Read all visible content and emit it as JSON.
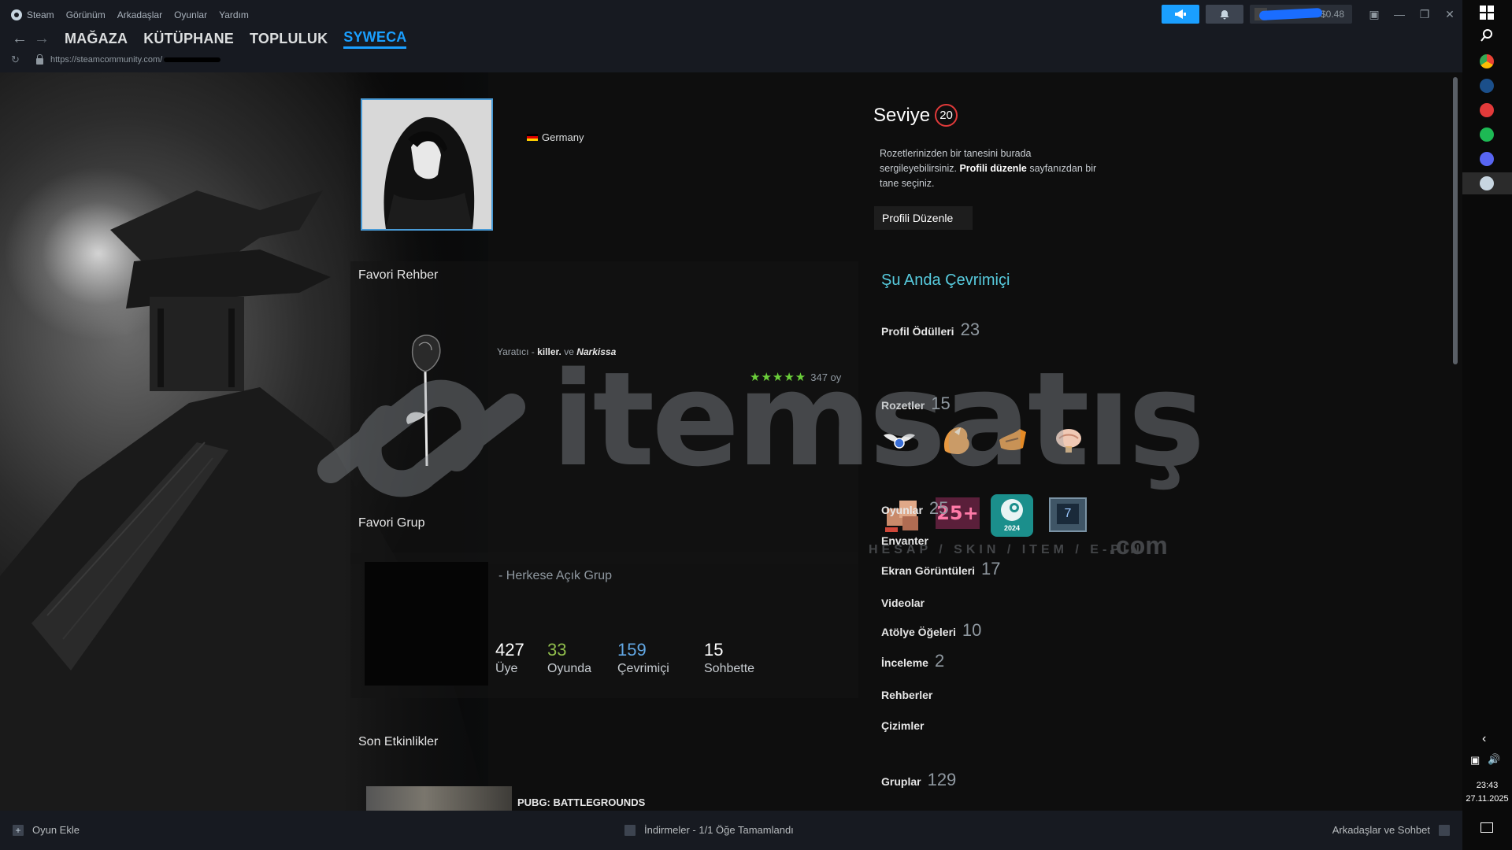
{
  "menu": {
    "app_name": "Steam",
    "items": [
      "Görünüm",
      "Arkadaşlar",
      "Oyunlar",
      "Yardım"
    ]
  },
  "nav": {
    "tabs": [
      "MAĞAZA",
      "KÜTÜPHANE",
      "TOPLULUK",
      "SYWECA"
    ],
    "active_tab": "SYWECA",
    "url": "https://steamcommunity.com/"
  },
  "account": {
    "balance": "$0.48"
  },
  "profile": {
    "country": "Germany",
    "level_label": "Seviye",
    "level": "20",
    "showcase_text_1": "Rozetlerinizden bir tanesini burada sergileyebilirsiniz.",
    "showcase_bold": "Profili düzenle",
    "showcase_text_2": "sayfanızdan bir tane seçiniz.",
    "edit_button": "Profili Düzenle",
    "online_status": "Şu Anda Çevrimiçi"
  },
  "guide": {
    "title": "Favori Rehber",
    "author_prefix": "Yaratıcı -",
    "author_1": "killer.",
    "author_joiner": "ve",
    "author_2": "Narkissa",
    "stars": "★★★★★",
    "votes": "347 oy"
  },
  "group": {
    "title": "Favori Grup",
    "type": "- Herkese Açık Grup",
    "stats": [
      {
        "num": "427",
        "label": "Üye",
        "color": "#ffffff"
      },
      {
        "num": "33",
        "label": "Oyunda",
        "color": "#8fbc4c"
      },
      {
        "num": "159",
        "label": "Çevrimiçi",
        "color": "#62a7e3"
      },
      {
        "num": "15",
        "label": "Sohbette",
        "color": "#ffffff"
      }
    ]
  },
  "activity": {
    "title": "Son Etkinlikler",
    "game": "PUBG: BATTLEGROUNDS"
  },
  "sidebar_links": [
    {
      "label": "Profil Ödülleri",
      "count": "23"
    },
    {
      "label": "Rozetler",
      "count": "15"
    },
    {
      "label": "Oyunlar",
      "count": "25"
    },
    {
      "label": "Envanter",
      "count": ""
    },
    {
      "label": "Ekran Görüntüleri",
      "count": "17"
    },
    {
      "label": "Videolar",
      "count": ""
    },
    {
      "label": "Atölye Öğeleri",
      "count": "10"
    },
    {
      "label": "İnceleme",
      "count": "2"
    },
    {
      "label": "Rehberler",
      "count": ""
    },
    {
      "label": "Çizimler",
      "count": ""
    },
    {
      "label": "Gruplar",
      "count": "129"
    }
  ],
  "badges": {
    "levels_badge_text": "25+",
    "year_badge_text": "2024",
    "years_badge_text": "7"
  },
  "watermark": {
    "brand": "itemsatış",
    "tagline": "HESAP / SKIN / ITEM / E-PIN",
    "domain": ".com"
  },
  "bottombar": {
    "add_game": "Oyun Ekle",
    "downloads": "İndirmeler - 1/1 Öğe Tamamlandı",
    "friends": "Arkadaşlar ve Sohbet"
  },
  "taskbar": {
    "time": "23:43",
    "date": "27.11.2025"
  },
  "colors": {
    "accent": "#1a9fff",
    "online": "#57cbde",
    "level_ring": "#e03a3a"
  }
}
